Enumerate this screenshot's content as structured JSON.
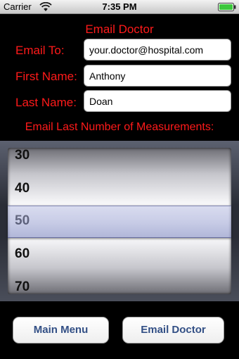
{
  "status_bar": {
    "carrier": "Carrier",
    "time": "7:35 PM",
    "wifi_icon": "wifi-icon",
    "battery_icon": "battery-icon",
    "battery_color": "#3cc73c"
  },
  "form": {
    "title": "Email Doctor",
    "email_to_label": "Email To:",
    "email_to_value": "your.doctor@hospital.com",
    "first_name_label": "First Name:",
    "first_name_value": "Anthony",
    "last_name_label": "Last Name:",
    "last_name_value": "Doan",
    "measurements_label": "Email Last Number of Measurements:",
    "label_color": "#ff1a1a"
  },
  "picker": {
    "options": [
      "30",
      "40",
      "50",
      "60",
      "70"
    ],
    "selected": "50"
  },
  "buttons": {
    "main_menu": "Main Menu",
    "email_doctor": "Email Doctor",
    "text_color": "#324f85"
  }
}
